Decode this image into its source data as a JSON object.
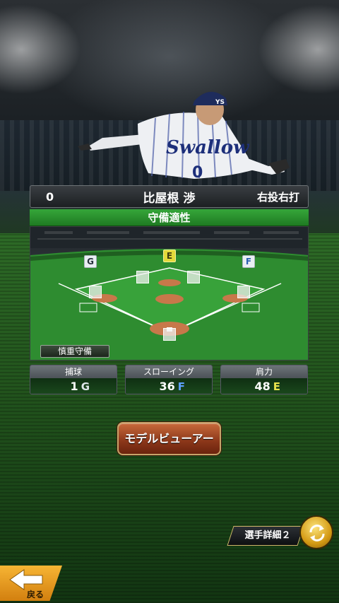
{
  "player": {
    "number": "0",
    "name": "比屋根 渉",
    "handedness": "右投右打"
  },
  "defense": {
    "title": "守備適性",
    "positions": [
      {
        "id": "left",
        "grade": "G"
      },
      {
        "id": "center",
        "grade": "E"
      },
      {
        "id": "right",
        "grade": "F"
      }
    ],
    "tag": "慎重守備"
  },
  "stats": [
    {
      "label": "捕球",
      "value": "1",
      "grade": "G"
    },
    {
      "label": "スローイング",
      "value": "36",
      "grade": "F"
    },
    {
      "label": "肩力",
      "value": "48",
      "grade": "E"
    }
  ],
  "buttons": {
    "model_viewer": "モデルビューアー",
    "player_detail": "選手詳細２",
    "back": "戻る"
  },
  "colors": {
    "header_green": "#2e9533",
    "grade_E": "#e4d93a",
    "grade_F": "#5fa1ff",
    "button_brown": "#8a3619",
    "back_orange": "#f2a52a"
  },
  "icons": {
    "cycle": "cycle-arrows-icon",
    "back": "back-arrow-icon"
  }
}
